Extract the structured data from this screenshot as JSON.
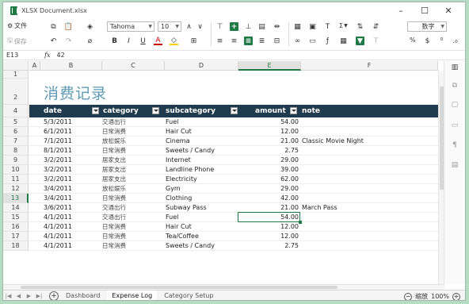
{
  "window": {
    "title": "XLSX Document.xlsx",
    "controls": {
      "minimize": "–",
      "maximize": "☐",
      "close": "✕"
    }
  },
  "ribbon": {
    "row1": {
      "settings": "文件",
      "font_name": "Tahoma",
      "font_size": "10",
      "number_format": "数字",
      "sum": "Σ"
    },
    "row2": {
      "save": "保存",
      "bold": "B",
      "italic": "I",
      "underline": "U",
      "font_color": "A",
      "percent": "%"
    }
  },
  "formula_bar": {
    "cell_ref": "E13",
    "fx": "fx",
    "value": "42"
  },
  "columns": [
    "A",
    "B",
    "C",
    "D",
    "E",
    "F"
  ],
  "rows": [
    "1",
    "2",
    "4",
    "5",
    "6",
    "7",
    "8",
    "9",
    "10",
    "11",
    "12",
    "13",
    "14",
    "15",
    "16",
    "17",
    "18"
  ],
  "sheet": {
    "title": "消费记录",
    "headers": {
      "date": "date",
      "category": "category",
      "subcategory": "subcategory",
      "amount": "amount",
      "note": "note"
    },
    "data": [
      {
        "date": "5/3/2011",
        "category": "交通出行",
        "subcategory": "Fuel",
        "amount": "54.00",
        "note": ""
      },
      {
        "date": "6/1/2011",
        "category": "日常消费",
        "subcategory": "Hair Cut",
        "amount": "12.00",
        "note": ""
      },
      {
        "date": "7/1/2011",
        "category": "放松娱乐",
        "subcategory": "Cinema",
        "amount": "21.00",
        "note": "Classic Movie Night"
      },
      {
        "date": "8/1/2011",
        "category": "日常消费",
        "subcategory": "Sweets / Candy",
        "amount": "2.75",
        "note": ""
      },
      {
        "date": "3/2/2011",
        "category": "居家支出",
        "subcategory": "Internet",
        "amount": "29.00",
        "note": ""
      },
      {
        "date": "3/2/2011",
        "category": "居家支出",
        "subcategory": "Landline Phone",
        "amount": "39.00",
        "note": ""
      },
      {
        "date": "3/2/2011",
        "category": "居家支出",
        "subcategory": "Electricity",
        "amount": "62.00",
        "note": ""
      },
      {
        "date": "3/4/2011",
        "category": "放松娱乐",
        "subcategory": "Gym",
        "amount": "29.00",
        "note": ""
      },
      {
        "date": "3/4/2011",
        "category": "日常消费",
        "subcategory": "Clothing",
        "amount": "42.00",
        "note": ""
      },
      {
        "date": "3/6/2011",
        "category": "交通出行",
        "subcategory": "Subway Pass",
        "amount": "21.00",
        "note": "March Pass"
      },
      {
        "date": "4/1/2011",
        "category": "交通出行",
        "subcategory": "Fuel",
        "amount": "54.00",
        "note": ""
      },
      {
        "date": "4/1/2011",
        "category": "日常消费",
        "subcategory": "Hair Cut",
        "amount": "12.00",
        "note": ""
      },
      {
        "date": "4/1/2011",
        "category": "日常消费",
        "subcategory": "Tea/Coffee",
        "amount": "12.00",
        "note": ""
      },
      {
        "date": "4/1/2011",
        "category": "日常消费",
        "subcategory": "Sweets / Candy",
        "amount": "2.75",
        "note": ""
      }
    ]
  },
  "tabs": [
    {
      "label": "Dashboard",
      "active": false
    },
    {
      "label": "Expense Log",
      "active": true
    },
    {
      "label": "Category Setup",
      "active": false
    }
  ],
  "status": {
    "zoom_label": "缩放",
    "zoom_value": "100%"
  },
  "colors": {
    "accent": "#1f7a46",
    "header_band": "#1f3b4d",
    "title": "#5e9bb3"
  }
}
